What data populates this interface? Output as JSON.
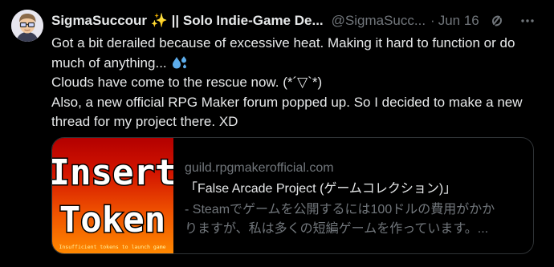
{
  "tweet": {
    "author": {
      "display_name": "SigmaSuccour ✨ || Solo Indie-Game De...",
      "handle": "@SigmaSucc...",
      "avatar_icon": "avatar-cartoon-glasses"
    },
    "separator": "·",
    "date": "Jun 16",
    "text_lines": [
      "Got a bit derailed because of excessive heat. Making it hard to function or do",
      "much of anything...",
      "Clouds have come to the rescue now. (*´▽`*)",
      "Also, a new official RPG Maker forum popped up. So I decided to make a new",
      "thread for my project there. XD"
    ],
    "icons": {
      "grok": "grok-icon",
      "more": "more-icon",
      "drops_emoji": "sweat-droplets-emoji"
    },
    "card": {
      "domain": "guild.rpgmakerofficial.com",
      "title": "「False Arcade Project (ゲームコレクション)」",
      "description_lines": [
        "- Steamでゲームを公開するには100ドルの費用がかか",
        "りますが、私は多くの短編ゲームを作っています。..."
      ],
      "thumbnail": {
        "line1": "Insert",
        "line2": "Token",
        "caption": "Insufficient tokens to launch game"
      }
    },
    "colors": {
      "background": "#000000",
      "text": "#e7e9ea",
      "muted": "#71767b",
      "border": "#2f3336",
      "thumb_top": "#b30000",
      "thumb_bottom": "#ff8a00"
    }
  }
}
